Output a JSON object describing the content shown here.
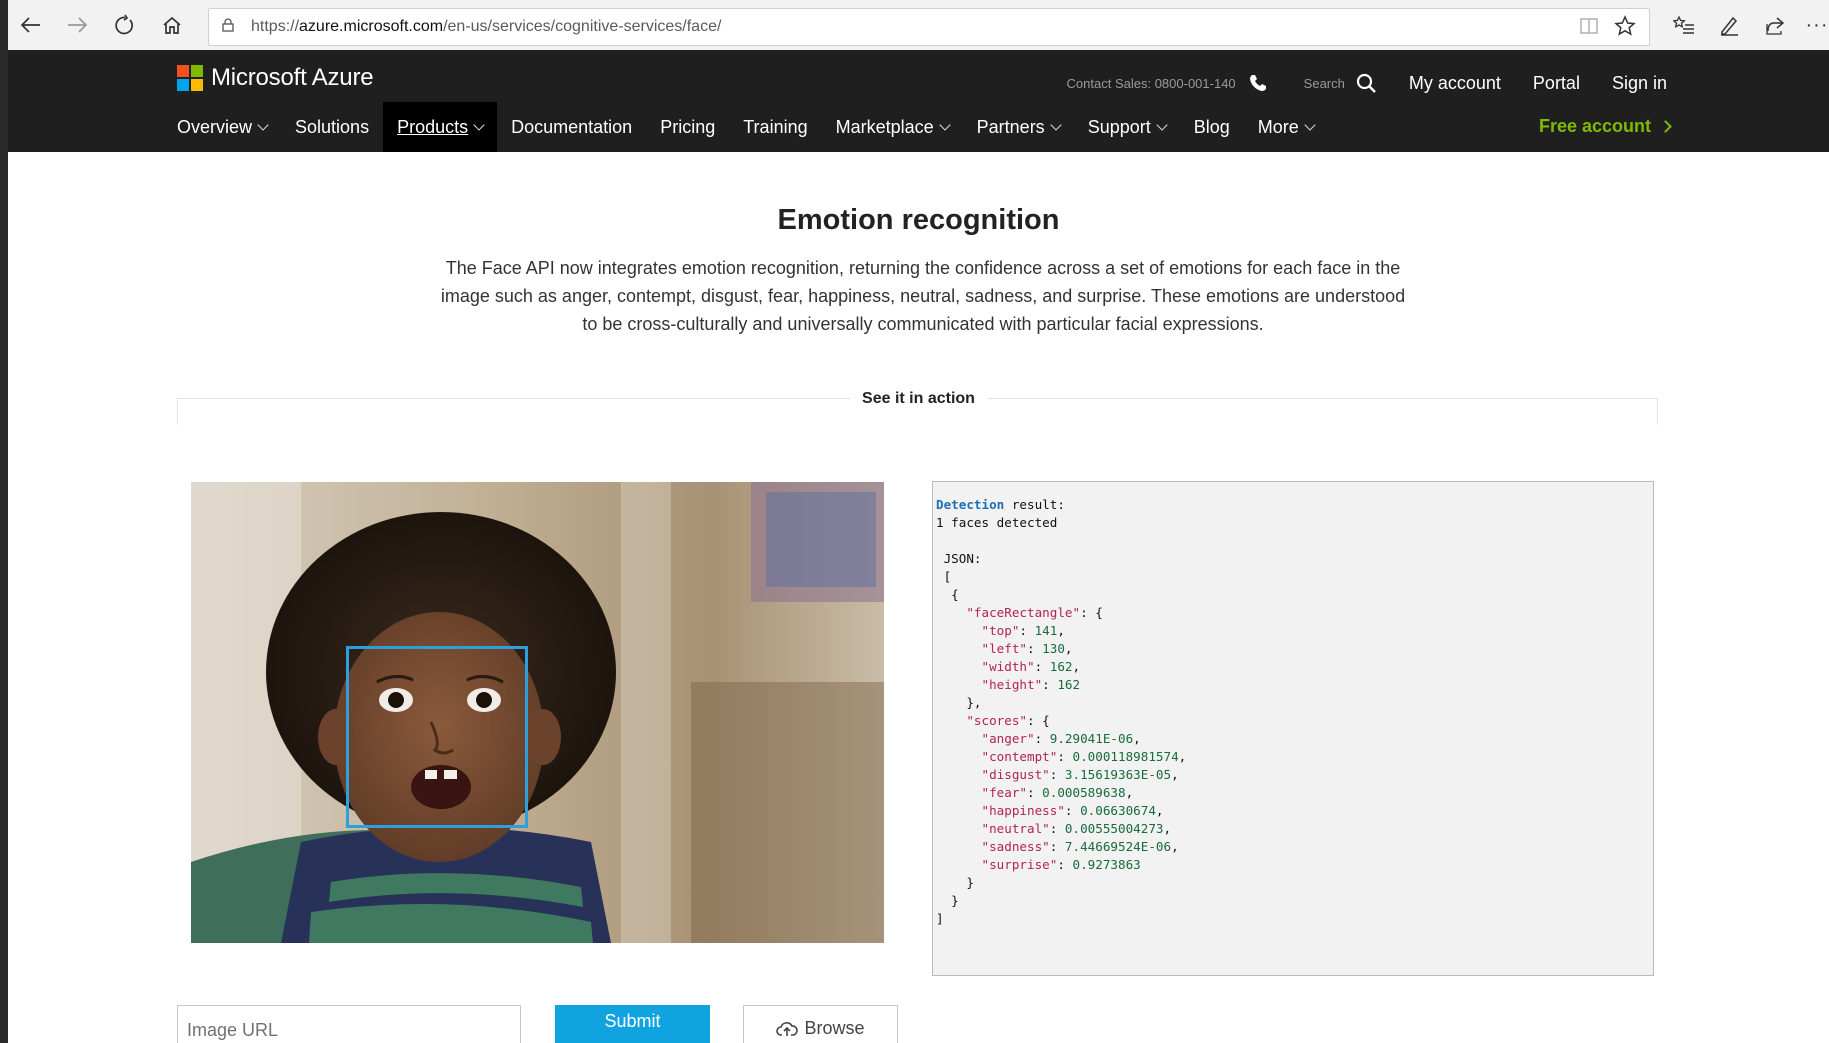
{
  "browser": {
    "url_prefix": "https://",
    "url_domain": "azure.microsoft.com",
    "url_path": "/en-us/services/cognitive-services/face/"
  },
  "header": {
    "brand": "Microsoft Azure",
    "brand_colors": [
      "#f25022",
      "#7fba00",
      "#00a4ef",
      "#ffb900"
    ],
    "contact": "Contact Sales: 0800-001-140",
    "search_label": "Search",
    "my_account": "My account",
    "portal": "Portal",
    "sign_in": "Sign in",
    "free_account": "Free account",
    "accent_color": "#7fba00"
  },
  "nav": {
    "items": [
      {
        "label": "Overview"
      },
      {
        "label": "Solutions"
      },
      {
        "label": "Products"
      },
      {
        "label": "Documentation"
      },
      {
        "label": "Pricing"
      },
      {
        "label": "Training"
      },
      {
        "label": "Marketplace"
      },
      {
        "label": "Partners"
      },
      {
        "label": "Support"
      },
      {
        "label": "Blog"
      },
      {
        "label": "More"
      }
    ],
    "active": "Products"
  },
  "main": {
    "title": "Emotion recognition",
    "description": "The Face API now integrates emotion recognition, returning the confidence across a set of emotions for each face in the image such as anger, contempt, disgust, fear, happiness, neutral, sadness, and surprise. These emotions are understood to be cross-culturally and universally communicated with particular facial expressions.",
    "section_label": "See it in action"
  },
  "result": {
    "heading_keyword": "Detection",
    "heading_rest": " result:",
    "faces_detected": "1 faces detected",
    "json_label": "JSON:",
    "face_rectangle": {
      "top": "141",
      "left": "130",
      "width": "162",
      "height": "162"
    },
    "scores": {
      "anger": "9.29041E-06",
      "contempt": "0.000118981574",
      "disgust": "3.15619363E-05",
      "fear": "0.000589638",
      "happiness": "0.06630674",
      "neutral": "0.00555004273",
      "sadness": "7.44669524E-06",
      "surprise": "0.9273863"
    }
  },
  "controls": {
    "image_url_placeholder": "Image URL",
    "submit_label": "Submit",
    "browse_label": "Browse",
    "submit_color": "#0fa3e0"
  }
}
